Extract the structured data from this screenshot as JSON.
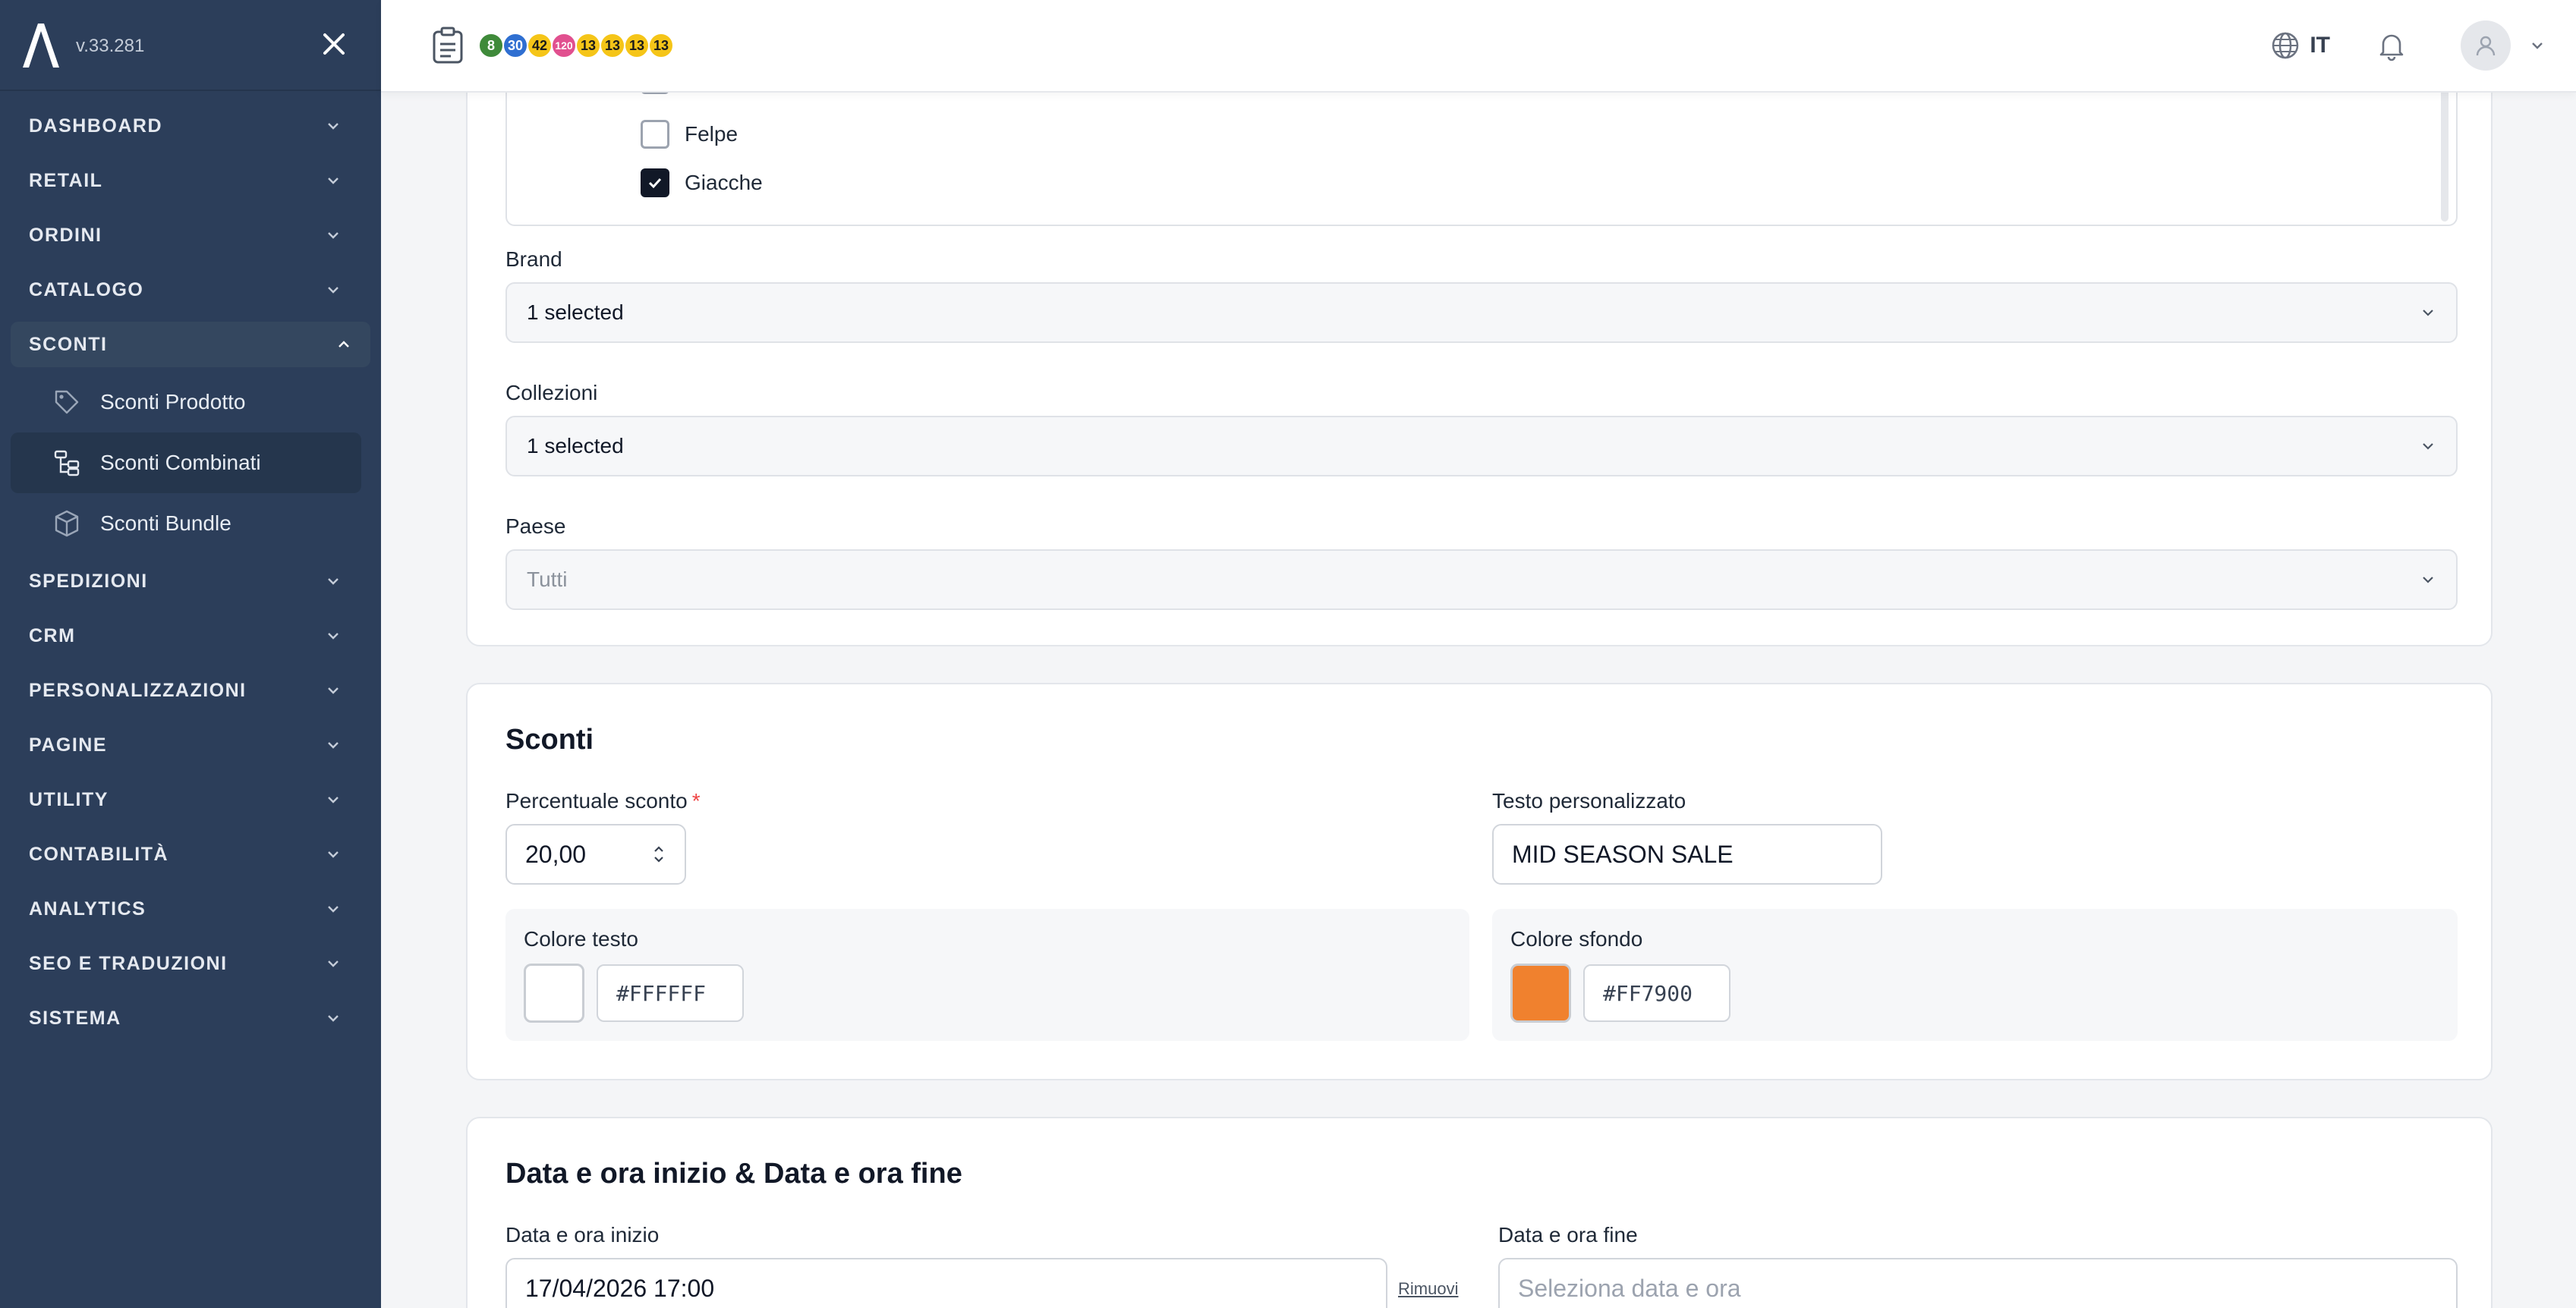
{
  "app": {
    "version": "v.33.281"
  },
  "sidebar": {
    "items": [
      {
        "label": "DASHBOARD"
      },
      {
        "label": "RETAIL"
      },
      {
        "label": "ORDINI"
      },
      {
        "label": "CATALOGO"
      },
      {
        "label": "SCONTI",
        "open": true
      },
      {
        "label": "SPEDIZIONI"
      },
      {
        "label": "CRM"
      },
      {
        "label": "PERSONALIZZAZIONI"
      },
      {
        "label": "PAGINE"
      },
      {
        "label": "UTILITY"
      },
      {
        "label": "CONTABILITÀ"
      },
      {
        "label": "ANALYTICS"
      },
      {
        "label": "SEO E TRADUZIONI"
      },
      {
        "label": "SISTEMA"
      }
    ],
    "sconti_sub": [
      {
        "label": "Sconti Prodotto",
        "icon": "tag-icon"
      },
      {
        "label": "Sconti Combinati",
        "icon": "hierarchy-icon",
        "active": true
      },
      {
        "label": "Sconti Bundle",
        "icon": "box-icon"
      }
    ]
  },
  "topbar": {
    "badges": [
      {
        "value": "8",
        "color": "#3f8a3a"
      },
      {
        "value": "30",
        "color": "#2f6fd1"
      },
      {
        "value": "42",
        "color": "#f5c518"
      },
      {
        "value": "120",
        "color": "#e1508f"
      },
      {
        "value": "13",
        "color": "#f5c518"
      },
      {
        "value": "13",
        "color": "#f5c518"
      },
      {
        "value": "13",
        "color": "#f5c518"
      },
      {
        "value": "13",
        "color": "#f5c518"
      }
    ],
    "language": "IT"
  },
  "filters": {
    "tree": [
      {
        "label": "Felpe",
        "checked": false
      },
      {
        "label": "Giacche",
        "checked": true
      }
    ],
    "brand": {
      "label": "Brand",
      "value": "1 selected"
    },
    "collezioni": {
      "label": "Collezioni",
      "value": "1 selected"
    },
    "paese": {
      "label": "Paese",
      "value": "Tutti"
    }
  },
  "sconti": {
    "title": "Sconti",
    "percent_label": "Percentuale sconto",
    "required_mark": "*",
    "percent_value": "20,00",
    "custom_text_label": "Testo personalizzato",
    "custom_text_value": "MID SEASON SALE",
    "text_color_label": "Colore testo",
    "text_color_value": "#FFFFFF",
    "bg_color_label": "Colore sfondo",
    "bg_color_value": "#FF7900"
  },
  "dates": {
    "title": "Data e ora inizio & Data e ora fine",
    "start_label": "Data e ora inizio",
    "start_value": "17/04/2026 17:00",
    "remove_label": "Rimuovi",
    "end_label": "Data e ora fine",
    "end_placeholder": "Seleziona data e ora"
  }
}
